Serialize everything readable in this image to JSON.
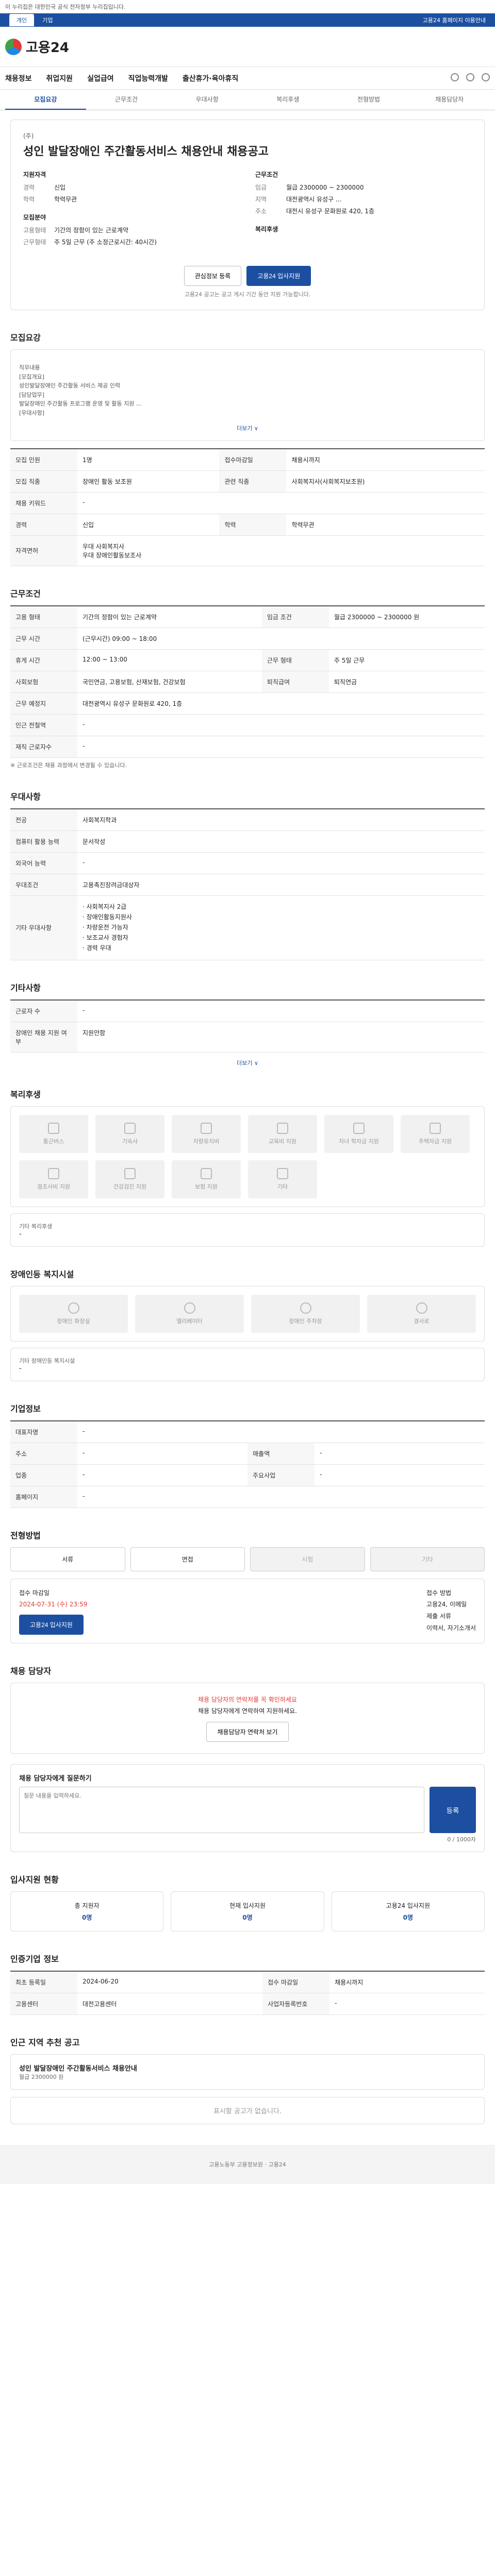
{
  "top": {
    "notice": "이 누리집은 대한민국 공식 전자정부 누리집입니다.",
    "tabs": [
      "개인",
      "기업"
    ],
    "right": "고용24 홈페이지 이용안내"
  },
  "logo": "고용24",
  "gnb": [
    "채용정보",
    "취업지원",
    "실업급여",
    "직업능력개발",
    "출산휴가·육아휴직"
  ],
  "subnav": [
    "모집요강",
    "근무조건",
    "우대사항",
    "복리후생",
    "전형방법",
    "채용담당자"
  ],
  "job": {
    "corp": "(주)",
    "title": "성인 발달장애인 주간활동서비스 채용안내 채용공고",
    "left_h": "지원자격",
    "left": [
      [
        "경력",
        "신입"
      ],
      [
        "학력",
        "학력무관"
      ]
    ],
    "left_h2": "모집분야",
    "left2": [
      [
        "고용형태",
        "기간의 정함이 있는 근로계약"
      ],
      [
        "근무형태",
        "주 5일 근무 (주 소정근로시간: 40시간)"
      ]
    ],
    "right_h": "근무조건",
    "right": [
      [
        "임금",
        "월급 2300000 ~ 2300000"
      ],
      [
        "지역",
        "대전광역시 유성구 ..."
      ],
      [
        "주소",
        "대전시 유성구 문화원로 420, 1층"
      ]
    ],
    "right_h2": "복리후생",
    "btn_fav": "관심정보 등록",
    "btn_apply": "고용24 입사지원",
    "btn_note": "고용24 공고는 공고 게시 기간 동안 지원 가능합니다."
  },
  "req": {
    "h": "모집요강",
    "text": "직무내용\n[모집개요]\n 성인발달장애인 주간활동 서비스 제공 인력\n[담당업무]\n 발달장애인 주간활동 프로그램 운영 및 활동 지원 ...\n[우대사항]",
    "expand": "더보기 ∨",
    "rows": [
      [
        "모집 인원",
        "1명",
        "접수마감일",
        "채용시까지"
      ],
      [
        "모집 직종",
        "장애인 활동 보조원",
        "관련 직종",
        "사회복지사(사회복지보조원)"
      ],
      [
        "채용 키워드",
        "-",
        "",
        ""
      ],
      [
        "경력",
        "신입",
        "학력",
        "학력무관"
      ],
      [
        "자격면허",
        "우대 사회복지사\n우대 장애인활동보조사",
        "",
        ""
      ]
    ]
  },
  "cond": {
    "h": "근무조건",
    "rows": [
      [
        "고용 형태",
        "기간의 정함이 있는 근로계약",
        "임금 조건",
        "월급 2300000 ~ 2300000 원"
      ],
      [
        "근무 시간",
        "(근무시간) 09:00 ~ 18:00",
        "",
        ""
      ],
      [
        "휴게 시간",
        "12:00 ~ 13:00",
        "근무 형태",
        "주 5일 근무"
      ],
      [
        "사회보험",
        "국민연금, 고용보험, 산재보험, 건강보험",
        "퇴직급여",
        "퇴직연금"
      ],
      [
        "근무 예정지",
        "대전광역시 유성구 문화원로 420, 1층",
        "",
        ""
      ],
      [
        "인근 전철역",
        "-",
        "",
        ""
      ],
      [
        "재직 근로자수",
        "-",
        "",
        ""
      ]
    ],
    "note": "※ 근로조건은 채용 과정에서 변경될 수 있습니다."
  },
  "pref": {
    "h": "우대사항",
    "rows": [
      [
        "전공",
        "사회복지학과"
      ],
      [
        "컴퓨터 활용 능력",
        "문서작성"
      ],
      [
        "외국어 능력",
        "-"
      ],
      [
        "우대조건",
        "고용촉진장려금대상자"
      ]
    ],
    "other": [
      "사회복지사 2급",
      "장애인활동지원사",
      "차량운전 가능자",
      "보조교사 경험자",
      "경력 우대"
    ]
  },
  "other": {
    "h": "기타사항",
    "rows": [
      [
        "근로자 수",
        "-"
      ],
      [
        "장애인 채용 지원 여부",
        "지원안함"
      ]
    ],
    "link": "더보기 ∨"
  },
  "welfare": {
    "h": "복리후생",
    "items": [
      "통근버스",
      "기숙사",
      "차량유지비",
      "교육비 지원",
      "자녀 학자금 지원",
      "주택자금 지원",
      "경조사비 지원",
      "건강검진 지원",
      "보험 지원",
      "기타"
    ],
    "sub": "기타 복리후생",
    "subv": "-"
  },
  "disab": {
    "h": "장애인등 복지시설",
    "items": [
      "장애인 화장실",
      "엘리베이터",
      "장애인 주차장",
      "경사로"
    ],
    "sub": "기타 장애인등 복지시설",
    "subv": "-"
  },
  "company": {
    "h": "기업정보",
    "rows": [
      [
        "대표자명",
        "-",
        "",
        ""
      ],
      [
        "주소",
        "-",
        "매출액",
        "-"
      ],
      [
        "업종",
        "-",
        "주요사업",
        "-"
      ],
      [
        "홈페이지",
        "-",
        "",
        ""
      ]
    ]
  },
  "process": {
    "h": "전형방법",
    "steps": [
      "서류",
      "면접",
      "시험",
      "기타"
    ],
    "l1": "접수 마감일",
    "v1": "2024-07-31 (수) 23:59",
    "l2": "접수 방법",
    "v2": "고용24, 이메일",
    "l3": "제출 서류",
    "v3": "이력서, 자기소개서",
    "apply": "고용24 입사지원"
  },
  "warning": {
    "h": "채용 담당자",
    "t1": "채용 담당자의 연락처를 꼭 확인하세요",
    "t2": "채용 담당자에게 연락하여 지원하세요.",
    "btn": "채용담당자 연락처 보기"
  },
  "qa": {
    "h": "채용 담당자에게 질문하기",
    "placeholder": "질문 내용을 입력하세요.",
    "btn": "등록",
    "count": "0 / 1000자"
  },
  "stats": {
    "h": "입사지원 현황",
    "items": [
      [
        "총 지원자",
        "0명"
      ],
      [
        "현재 입사지원",
        "0명"
      ],
      [
        "고용24 입사지원",
        "0명"
      ]
    ]
  },
  "history": {
    "h": "인증기업 정보",
    "rows": [
      [
        "최초 등록일",
        "2024-06-20",
        "접수 마감일",
        "채용시까지"
      ],
      [
        "고용센터",
        "대전고용센터",
        "사업자등록번호",
        "-"
      ]
    ]
  },
  "nearby": {
    "h": "인근 지역 추천 공고",
    "title": "성인 발달장애인 주간활동서비스 채용안내",
    "meta": "월급 2300000 원",
    "empty": "표시할 공고가 없습니다."
  },
  "footer": "고용노동부 고용정보원 · 고용24"
}
